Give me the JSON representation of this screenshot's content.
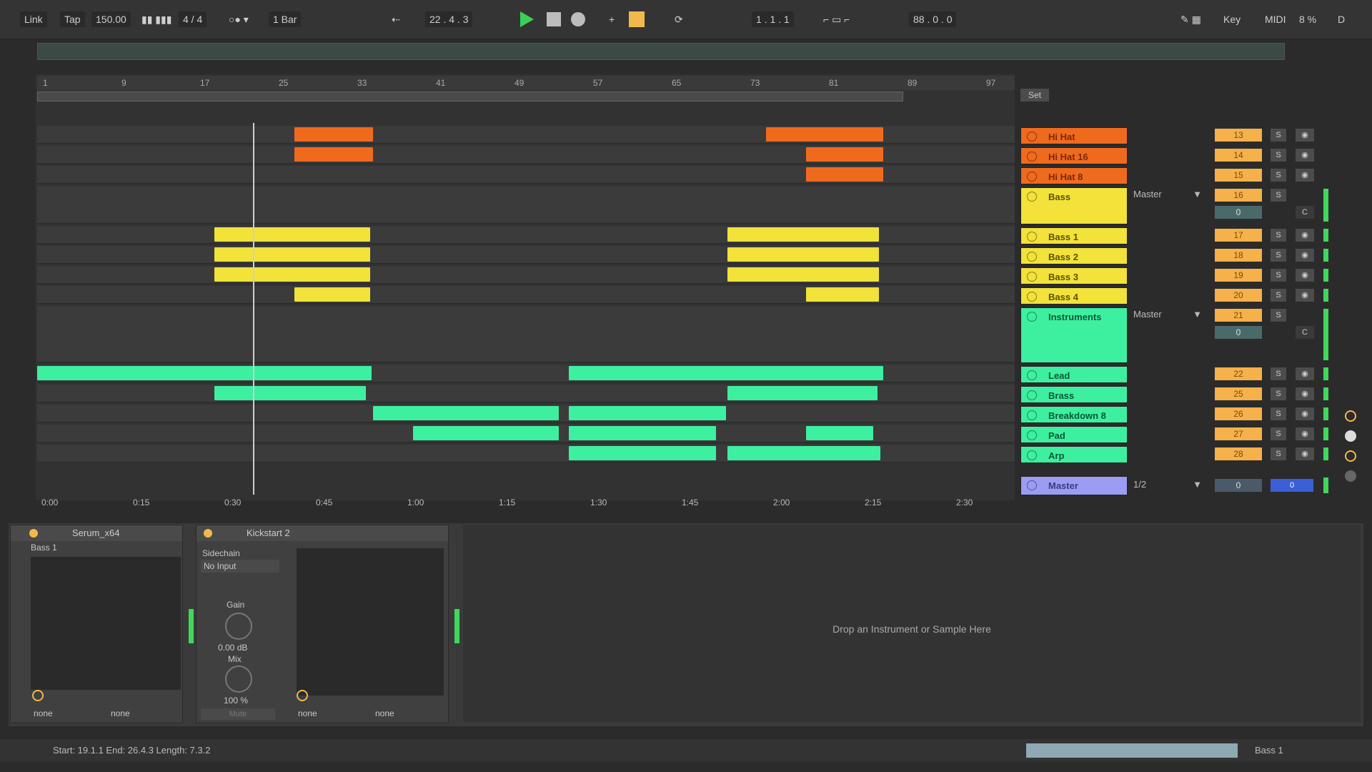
{
  "topbar": {
    "link": "Link",
    "tap": "Tap",
    "tempo": "150.00",
    "signature": "4 / 4",
    "quantize": "1 Bar",
    "arrangement_position": "22 .   4 .   3",
    "loop_start": "1 .   1 .   1",
    "loop_length": "88 .   0 .   0",
    "key": "Key",
    "midi": "MIDI",
    "cpu": "8 %",
    "d": "D"
  },
  "ruler": {
    "bars": [
      "1",
      "9",
      "17",
      "25",
      "33",
      "41",
      "49",
      "57",
      "65",
      "73",
      "81",
      "89",
      "97"
    ]
  },
  "timeline": {
    "times": [
      "0:00",
      "0:15",
      "0:30",
      "0:45",
      "1:00",
      "1:15",
      "1:30",
      "1:45",
      "2:00",
      "2:15",
      "2:30"
    ]
  },
  "set_label": "Set",
  "tracks": [
    {
      "name": "Hi Hat",
      "num": "13",
      "color": "o"
    },
    {
      "name": "Hi Hat 16",
      "num": "14",
      "color": "o"
    },
    {
      "name": "Hi Hat 8",
      "num": "15",
      "color": "o"
    },
    {
      "name": "Bass",
      "num": "16",
      "color": "y",
      "route": "Master",
      "group": true
    },
    {
      "name": "Bass 1",
      "num": "17",
      "color": "y"
    },
    {
      "name": "Bass 2",
      "num": "18",
      "color": "y"
    },
    {
      "name": "Bass 3",
      "num": "19",
      "color": "y"
    },
    {
      "name": "Bass 4",
      "num": "20",
      "color": "y"
    },
    {
      "name": "Instruments",
      "num": "21",
      "color": "g",
      "route": "Master",
      "group": true
    },
    {
      "name": "Lead",
      "num": "22",
      "color": "g"
    },
    {
      "name": "Brass",
      "num": "25",
      "color": "g"
    },
    {
      "name": "Breakdown 8",
      "num": "26",
      "color": "g"
    },
    {
      "name": "Pad",
      "num": "27",
      "color": "g"
    },
    {
      "name": "Arp",
      "num": "28",
      "color": "g"
    }
  ],
  "master": {
    "name": "Master",
    "route": "1/2",
    "vol": "0",
    "pan": "0"
  },
  "group_vol": "0",
  "group_pan": "C",
  "solo_label": "S",
  "devices": {
    "serum": {
      "title": "Serum_x64",
      "preset": "Bass 1",
      "in1": "none",
      "in2": "none"
    },
    "kickstart": {
      "title": "Kickstart 2",
      "sidechain_label": "Sidechain",
      "sidechain_input": "No Input",
      "gain_label": "Gain",
      "gain_value": "0.00 dB",
      "mix_label": "Mix",
      "mix_value": "100 %",
      "mute": "Mute",
      "out1": "none",
      "out2": "none"
    },
    "drop_hint": "Drop an Instrument or Sample Here"
  },
  "status": {
    "selection": "Start: 19.1.1  End: 26.4.3  Length: 7.3.2",
    "current_track": "Bass 1"
  },
  "colors": {
    "orange": "#f06a1e",
    "yellow": "#f2e23a",
    "green": "#3cf0a0",
    "master": "#9c9cf4"
  }
}
